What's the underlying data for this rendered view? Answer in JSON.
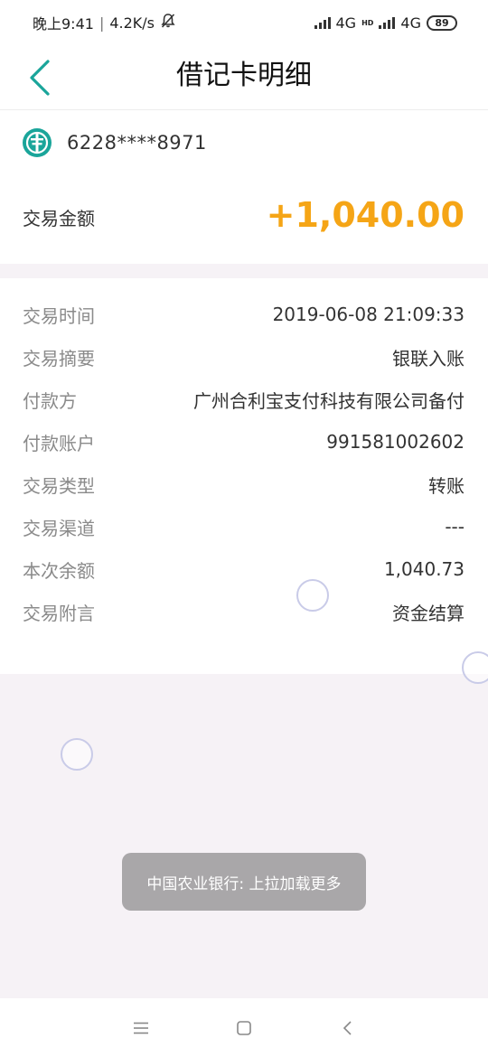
{
  "status_bar": {
    "time": "晚上9:41",
    "separator": "|",
    "net_speed": "4.2K/s",
    "network1": "4G",
    "hd_label": "HD",
    "network2": "4G",
    "battery": "89",
    "icons": [
      "bell-off-icon",
      "signal-icon",
      "signal-icon",
      "battery-icon"
    ]
  },
  "header": {
    "title": "借记卡明细",
    "back_icon": "chevron-left-icon"
  },
  "card": {
    "number": "6228****8971",
    "logo_icon": "abc-bank-logo-icon"
  },
  "amount": {
    "label": "交易金额",
    "value": "+1,040.00"
  },
  "details": [
    {
      "label": "交易时间",
      "value": "2019-06-08 21:09:33"
    },
    {
      "label": "交易摘要",
      "value": "银联入账"
    },
    {
      "label": "付款方",
      "value": "广州合利宝支付科技有限公司备付"
    },
    {
      "label": "付款账户",
      "value": "991581002602"
    },
    {
      "label": "交易类型",
      "value": "转账"
    },
    {
      "label": "交易渠道",
      "value": "---"
    },
    {
      "label": "本次余额",
      "value": "1,040.73"
    },
    {
      "label": "交易附言",
      "value": "资金结算"
    }
  ],
  "toast": {
    "text": "中国农业银行: 上拉加载更多"
  },
  "nav": {
    "icons": [
      "menu-icon",
      "home-square-icon",
      "back-chevron-icon"
    ]
  },
  "colors": {
    "accent_teal": "#1aa59a",
    "amount_orange": "#f5a516",
    "page_bg": "#f6f2f6"
  }
}
